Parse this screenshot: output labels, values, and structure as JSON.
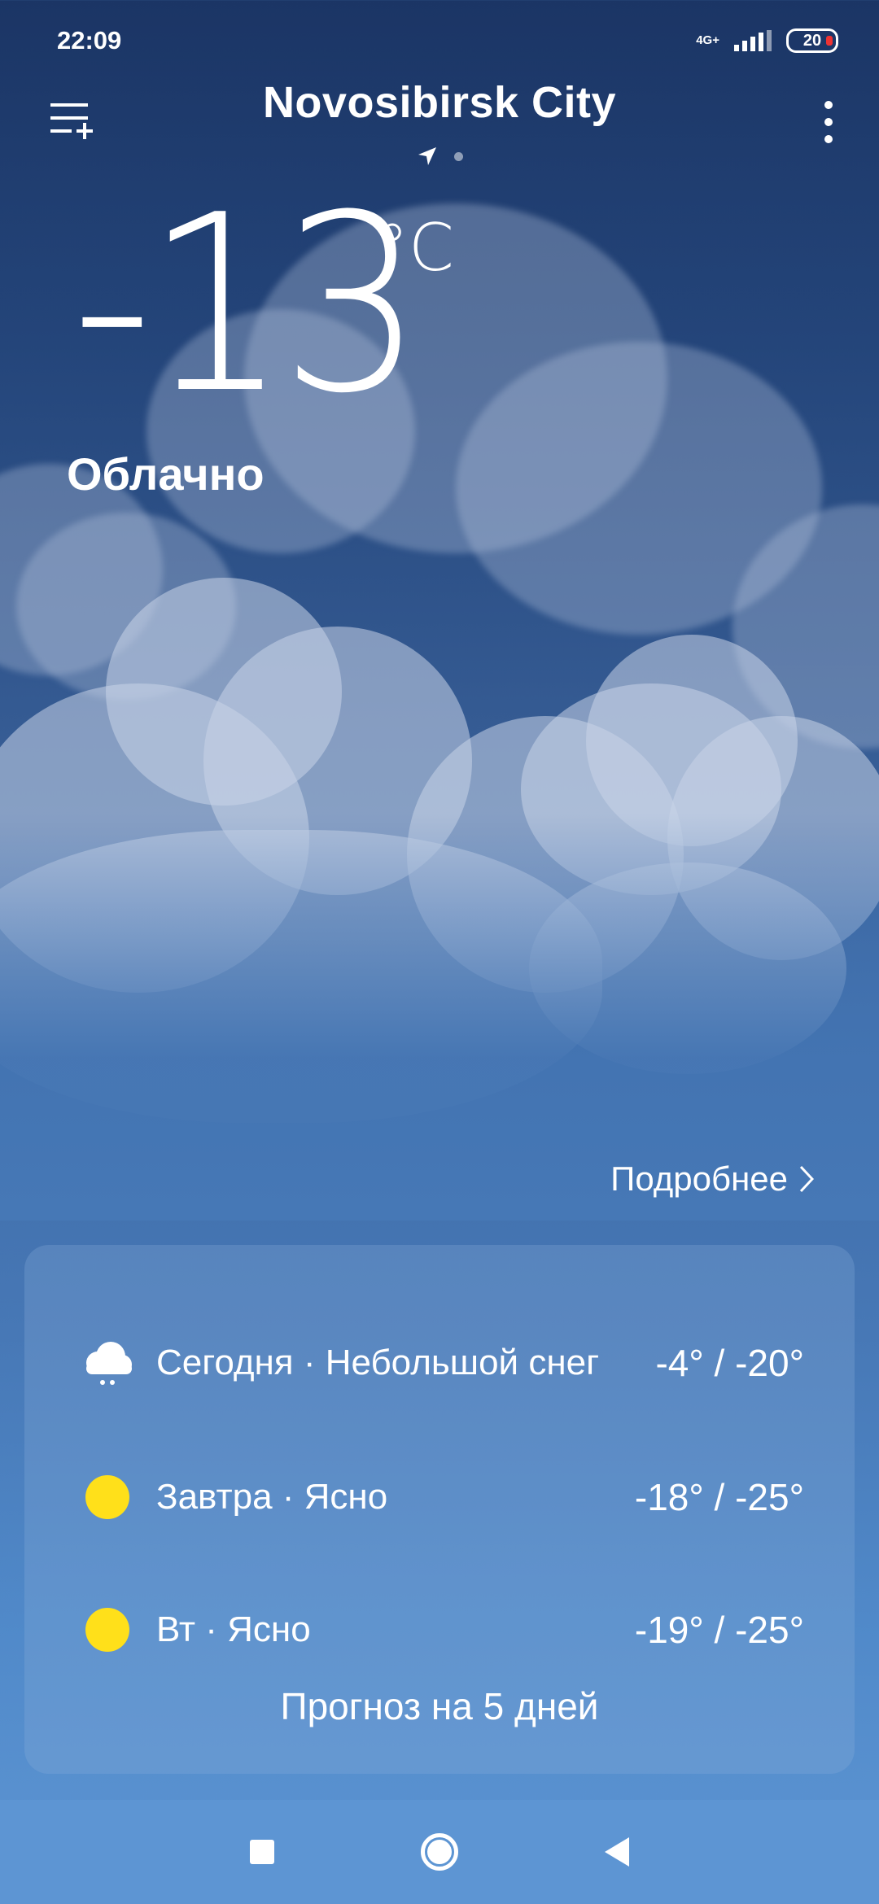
{
  "status_bar": {
    "time": "22:09",
    "network": "4G+",
    "battery": "20"
  },
  "header": {
    "city": "Novosibirsk City"
  },
  "current": {
    "temperature": "-13",
    "unit": "°C",
    "condition": "Облачно"
  },
  "details_link": "Подробнее",
  "forecast": {
    "days": [
      {
        "label": "Сегодня · Небольшой снег",
        "range": "-4° / -20°",
        "icon": "light-snow-icon"
      },
      {
        "label": "Завтра · Ясно",
        "range": "-18° / -25°",
        "icon": "sun-icon"
      },
      {
        "label": "Вт · Ясно",
        "range": "-19° / -25°",
        "icon": "sun-icon"
      }
    ],
    "five_day_label": "Прогноз на 5 дней"
  },
  "colors": {
    "sun": "#ffe01a",
    "background_top": "#1b3565",
    "background_bottom": "#5d95d3"
  }
}
